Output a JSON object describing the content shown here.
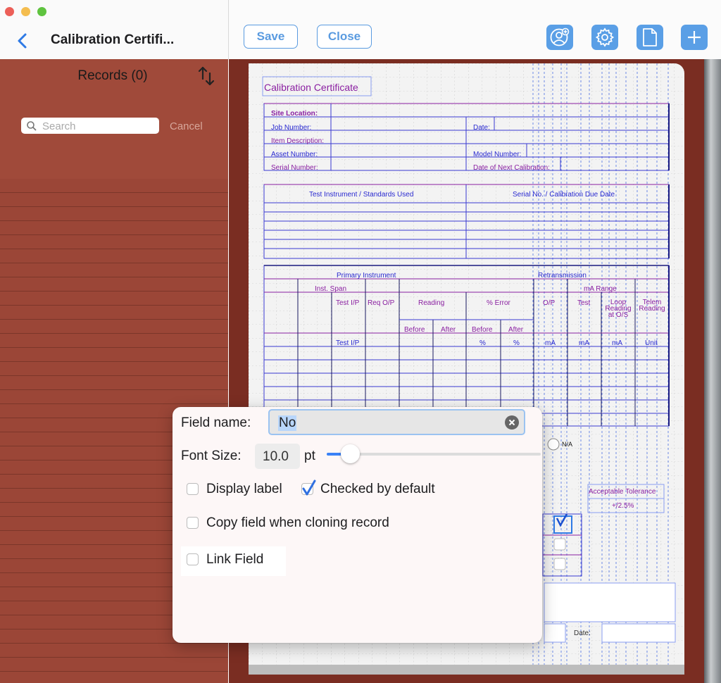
{
  "window": {
    "title": "Calibration Certifi..."
  },
  "toolbar": {
    "save_label": "Save",
    "close_label": "Close"
  },
  "sidebar": {
    "records_title": "Records (0)",
    "search_placeholder": "Search",
    "cancel_label": "Cancel"
  },
  "form": {
    "title": "Calibration Certificate",
    "header_fields": {
      "site_location": "Site Location:",
      "job_number": "Job Number:",
      "date": "Date:",
      "item_description": "Item Description:",
      "asset_number": "Asset Number:",
      "model_number": "Model Number:",
      "serial_number": "Serial Number:",
      "next_calibration": "Date of Next Calibration:"
    },
    "instruments": {
      "col1": "Test Instrument / Standards Used",
      "col2": "Serial No. / Calibration Due Date"
    },
    "table": {
      "primary": "Primary Instrument",
      "retransmission": "Retransmission",
      "inst_span": "Inst. Span",
      "ma_range": "mA Range",
      "test_ip": "Test I/P",
      "req_op": "Req O/P",
      "reading": "Reading",
      "pct_error": "% Error",
      "op": "O/P",
      "test": "Test",
      "loop_reading": "Loop Reading at O/S",
      "telem_reading": "Telem Reading",
      "before": "Before",
      "after": "After",
      "before2": "Before",
      "after2": "After",
      "unit_test_ip": "Test I/P",
      "unit_pct1": "%",
      "unit_pct2": "%",
      "unit_ma1": "mA",
      "unit_ma2": "mA",
      "unit_ma3": "mA",
      "unit_unit": "Unit"
    },
    "na_label": "N/A",
    "acceptable_tolerance": "Acceptable Tolerance",
    "tolerance_value": "+/2.5%",
    "date_label": "Date:"
  },
  "popover": {
    "field_name_label": "Field name:",
    "field_name_value": "No",
    "font_size_label": "Font Size:",
    "font_size_value": "10.0",
    "font_size_unit": "pt",
    "font_size_slider_fraction": 0.05,
    "display_label": "Display label",
    "display_label_checked": false,
    "checked_by_default": "Checked by default",
    "checked_by_default_checked": true,
    "copy_field": "Copy field when cloning record",
    "copy_field_checked": false,
    "link_field": "Link Field",
    "link_field_checked": false
  }
}
